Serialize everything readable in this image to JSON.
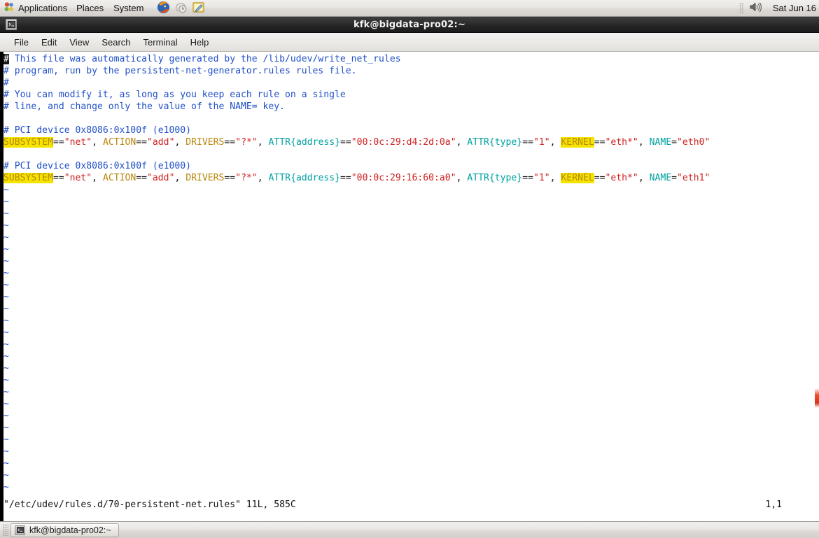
{
  "panel": {
    "apps_label": "Applications",
    "places_label": "Places",
    "system_label": "System",
    "launchers": [
      {
        "name": "firefox-icon",
        "title": "Firefox Web Browser"
      },
      {
        "name": "help-icon",
        "title": "Help"
      },
      {
        "name": "text-editor-icon",
        "title": "Text Editor"
      }
    ],
    "volume_icon": "volume-icon",
    "clock": "Sat Jun 16"
  },
  "window": {
    "title": "kfk@bigdata-pro02:~",
    "menubar": [
      "File",
      "Edit",
      "View",
      "Search",
      "Terminal",
      "Help"
    ]
  },
  "terminal": {
    "lines": [
      {
        "type": "comment",
        "cursor": true,
        "text": "# This file was automatically generated by the /lib/udev/write_net_rules"
      },
      {
        "type": "comment",
        "text": "# program, run by the persistent-net-generator.rules rules file."
      },
      {
        "type": "comment",
        "text": "#"
      },
      {
        "type": "comment",
        "text": "# You can modify it, as long as you keep each rule on a single"
      },
      {
        "type": "comment",
        "text": "# line, and change only the value of the NAME= key."
      },
      {
        "type": "blank",
        "text": ""
      },
      {
        "type": "comment",
        "text": "# PCI device 0x8086:0x100f (e1000)"
      },
      {
        "type": "rule",
        "mac": "00:0c:29:d4:2d:0a",
        "name": "eth0"
      },
      {
        "type": "blank",
        "text": ""
      },
      {
        "type": "comment",
        "text": "# PCI device 0x8086:0x100f (e1000)"
      },
      {
        "type": "rule",
        "mac": "00:0c:29:16:60:a0",
        "name": "eth1"
      }
    ],
    "rule_tokens": {
      "subsystem_key": "SUBSYSTEM",
      "subsystem_val": "\"net\"",
      "action_key": "ACTION",
      "action_val": "\"add\"",
      "drivers_key": "DRIVERS",
      "drivers_val": "\"?*\"",
      "attr_address_key": "ATTR{address}",
      "attr_type_key": "ATTR{type}",
      "attr_type_val": "\"1\"",
      "kernel_key": "KERNEL",
      "kernel_val": "\"eth*\"",
      "name_key": "NAME",
      "eq2": "==",
      "eq1": "=",
      "sep": ", "
    },
    "tilde": "~",
    "tilde_rows": 26,
    "status_file": "\"/etc/udev/rules.d/70-persistent-net.rules\" 11L, 585C",
    "status_position": "1,1"
  },
  "taskbar": {
    "window_button": "kfk@bigdata-pro02:~",
    "window_icon": "terminal-icon"
  },
  "colors": {
    "comment": "#2050c8",
    "identifier": "#b8860b",
    "string": "#d02020",
    "attribute": "#00a0a0",
    "search_highlight": "#f5e400",
    "terminal_bg": "#ffffff",
    "titlebar_bg": "#242424"
  }
}
